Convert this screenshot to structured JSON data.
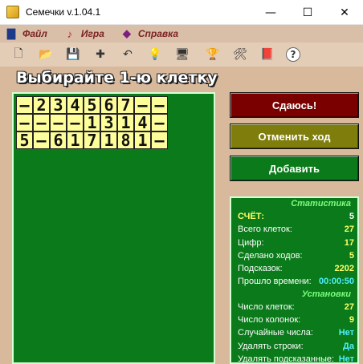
{
  "window": {
    "title": "Семечки v.1.04.1",
    "minimize": "—",
    "maximize": "☐",
    "close": "✕"
  },
  "menu": [
    {
      "label": "Файл",
      "icon": "book-icon"
    },
    {
      "label": "Игра",
      "icon": "guitar-icon"
    },
    {
      "label": "Справка",
      "icon": "help-book-icon"
    }
  ],
  "toolbar": [
    {
      "name": "new-file-icon",
      "glyph": "🗋"
    },
    {
      "name": "open-folder-icon",
      "glyph": "📂"
    },
    {
      "name": "save-icon",
      "glyph": "💾"
    },
    {
      "name": "add-cross-icon",
      "glyph": "✚"
    },
    {
      "name": "undo-icon",
      "glyph": "↶"
    },
    {
      "name": "hint-bulb-icon",
      "glyph": "💡"
    },
    {
      "name": "computer-icon",
      "glyph": "🖥"
    },
    {
      "name": "trophy-icon",
      "glyph": "🏆"
    },
    {
      "name": "settings-tools-icon",
      "glyph": "🛠"
    },
    {
      "name": "book-icon",
      "glyph": "📕"
    },
    {
      "name": "help-icon",
      "glyph": "?"
    }
  ],
  "heading": "Выбирайте 1-ю клетку",
  "grid": [
    [
      "—",
      "2",
      "3",
      "4",
      "5",
      "6",
      "7",
      "—",
      "—"
    ],
    [
      "—",
      "—",
      "—",
      "—",
      "1",
      "3",
      "1",
      "4",
      "—"
    ],
    [
      "5",
      "—",
      "6",
      "1",
      "7",
      "1",
      "8",
      "1",
      "—"
    ]
  ],
  "buttons": {
    "give_up": "Сдаюсь!",
    "undo": "Отменить ход",
    "add": "Добавить"
  },
  "stats": {
    "title": "Статистика",
    "rows": [
      {
        "label": "СЧЁТ:",
        "value": "5"
      },
      {
        "label": "Всего клеток:",
        "value": "27"
      },
      {
        "label": "Цифр:",
        "value": "17"
      },
      {
        "label": "Сделано ходов:",
        "value": "5"
      },
      {
        "label": "Подсказок:",
        "value": "2202"
      },
      {
        "label": "Прошло времени:",
        "value": "00:00:50"
      }
    ],
    "settings_title": "Установки",
    "settings": [
      {
        "label": "Число клеток:",
        "value": "27"
      },
      {
        "label": "Число колонок:",
        "value": "9"
      },
      {
        "label": "Случайные числа:",
        "value": "Нет"
      },
      {
        "label": "Удалять строки:",
        "value": "Да"
      },
      {
        "label": "Удалять подсказанные:",
        "value": "Нет"
      }
    ]
  }
}
